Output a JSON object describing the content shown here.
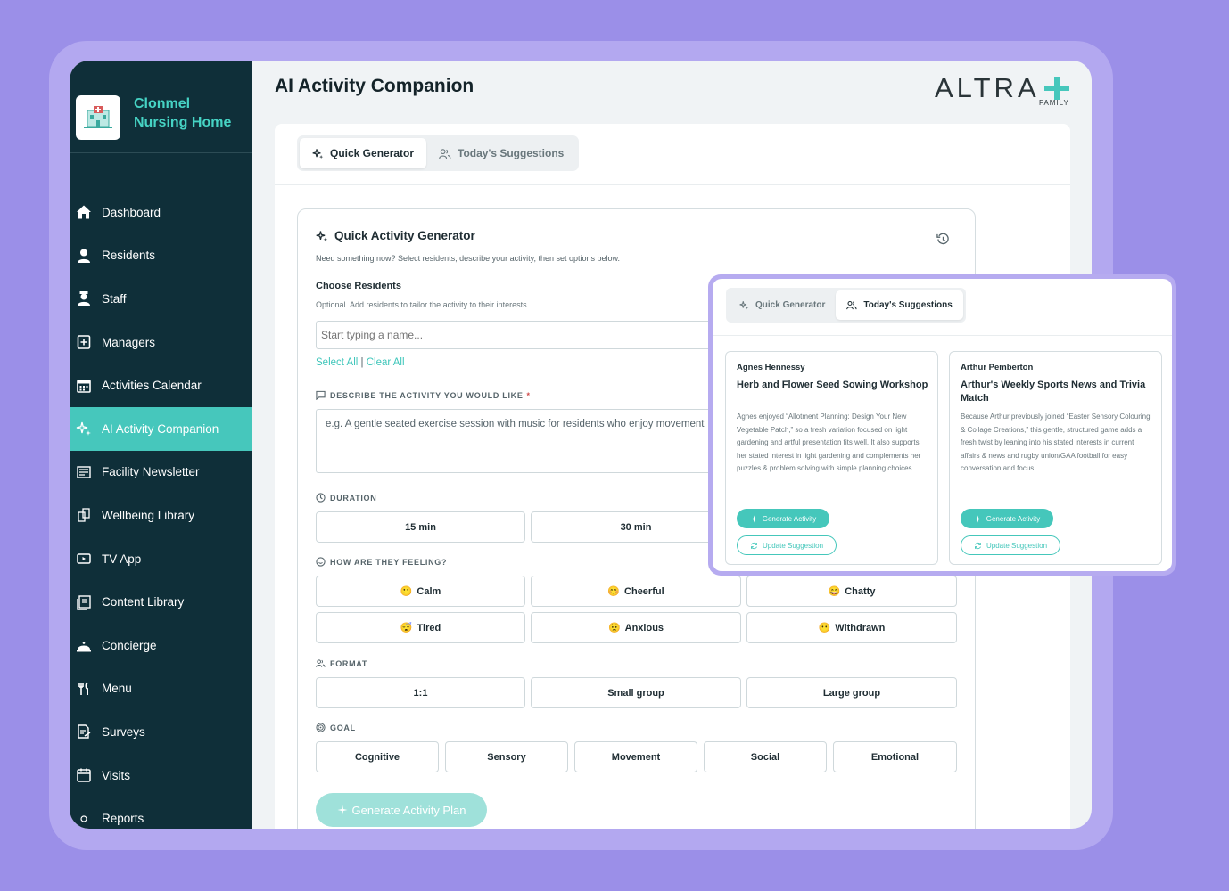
{
  "facility": {
    "name": "Clonmel Nursing Home"
  },
  "sidebar": {
    "items": [
      {
        "label": "Dashboard",
        "icon": "home-icon"
      },
      {
        "label": "Residents",
        "icon": "user-icon"
      },
      {
        "label": "Staff",
        "icon": "staff-icon"
      },
      {
        "label": "Managers",
        "icon": "badge-icon"
      },
      {
        "label": "Activities Calendar",
        "icon": "calendar-icon"
      },
      {
        "label": "AI Activity Companion",
        "icon": "sparkle-icon",
        "active": true
      },
      {
        "label": "Facility Newsletter",
        "icon": "newsletter-icon"
      },
      {
        "label": "Wellbeing Library",
        "icon": "library-icon"
      },
      {
        "label": "TV App",
        "icon": "tv-icon"
      },
      {
        "label": "Content Library",
        "icon": "content-icon"
      },
      {
        "label": "Concierge",
        "icon": "bell-icon"
      },
      {
        "label": "Menu",
        "icon": "cutlery-icon"
      },
      {
        "label": "Surveys",
        "icon": "survey-icon"
      },
      {
        "label": "Visits",
        "icon": "visit-calendar-icon"
      },
      {
        "label": "Reports",
        "icon": "report-icon"
      }
    ]
  },
  "header": {
    "title": "AI Activity Companion",
    "brand": "ALTRA",
    "brand_sub": "FAMILY"
  },
  "tabs": {
    "quick": "Quick Generator",
    "today": "Today's Suggestions"
  },
  "generator": {
    "title": "Quick Activity Generator",
    "description": "Need something now? Select residents, describe your activity, then set options below.",
    "choose_residents": "Choose Residents",
    "residents_note": "Optional. Add residents to tailor the activity to their interests.",
    "name_placeholder": "Start typing a name...",
    "select_all": "Select All",
    "separator": "|",
    "clear_all": "Clear All",
    "describe_label": "DESCRIBE THE ACTIVITY YOU WOULD LIKE",
    "required_mark": "*",
    "describe_placeholder": "e.g. A gentle seated exercise session with music for residents who enjoy movement",
    "duration_label": "DURATION",
    "durations": [
      "15 min",
      "30 min"
    ],
    "feeling_label": "HOW ARE THEY FEELING?",
    "feelings": [
      {
        "label": "Calm",
        "emoji": "🙂"
      },
      {
        "label": "Cheerful",
        "emoji": "😊"
      },
      {
        "label": "Chatty",
        "emoji": "😄"
      },
      {
        "label": "Tired",
        "emoji": "😴"
      },
      {
        "label": "Anxious",
        "emoji": "😟"
      },
      {
        "label": "Withdrawn",
        "emoji": "😶"
      }
    ],
    "format_label": "FORMAT",
    "formats": [
      "1:1",
      "Small group",
      "Large group"
    ],
    "goal_label": "GOAL",
    "goals": [
      "Cognitive",
      "Sensory",
      "Movement",
      "Social",
      "Emotional"
    ],
    "generate_label": "Generate Activity Plan"
  },
  "suggestions": [
    {
      "resident": "Agnes Hennessy",
      "activity": "Herb and Flower Seed Sowing Workshop",
      "reason": "Agnes enjoyed “Allotment Planning: Design Your New Vegetable Patch,” so a fresh variation focused on light gardening and artful presentation fits well. It also supports her stated interest in light gardening and complements her puzzles & problem solving with simple planning choices.",
      "generate": "Generate Activity",
      "update": "Update Suggestion"
    },
    {
      "resident": "Arthur Pemberton",
      "activity": "Arthur's Weekly Sports News and Trivia Match",
      "reason": "Because Arthur previously joined “Easter Sensory Colouring & Collage Creations,” this gentle, structured game adds a fresh twist by leaning into his stated interests in current affairs & news and rugby union/GAA football for easy conversation and focus.",
      "generate": "Generate Activity",
      "update": "Update Suggestion"
    }
  ],
  "colors": {
    "accent": "#46c7bc",
    "sidebar": "#0f2f39",
    "background": "#9b8fe8"
  }
}
